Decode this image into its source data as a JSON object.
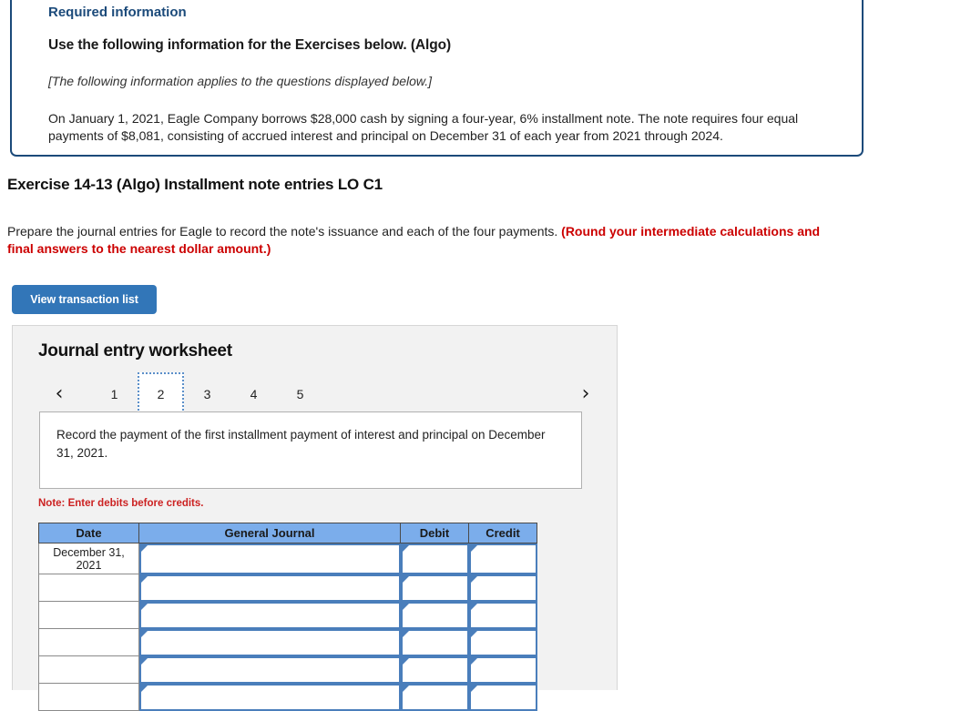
{
  "required_info": {
    "label": "Required information",
    "heading": "Use the following information for the Exercises below. (Algo)",
    "applies_note": "[The following information applies to the questions displayed below.]",
    "body": "On January 1, 2021, Eagle Company borrows $28,000 cash by signing a four-year, 6% installment note. The note requires four equal payments of $8,081, consisting of accrued interest and principal on December 31 of each year from 2021 through 2024.",
    "border_color": "#1b4a7a",
    "label_color": "#1b4a7a"
  },
  "exercise": {
    "title": "Exercise 14-13 (Algo) Installment note entries LO C1",
    "instruction_plain": "Prepare the journal entries for Eagle to record the note's issuance and each of the four payments. ",
    "instruction_emphasis": "(Round your intermediate calculations and final answers to the nearest dollar amount.)",
    "emphasis_color": "#cc0000"
  },
  "buttons": {
    "view_transaction_list": "View transaction list",
    "view_transaction_list_color": "#3276b8"
  },
  "worksheet": {
    "title": "Journal entry worksheet",
    "pager": {
      "prev_icon": "chevron-left-icon",
      "next_icon": "chevron-right-icon",
      "prev_glyph": "‹",
      "next_glyph": "›",
      "tabs": [
        "1",
        "2",
        "3",
        "4",
        "5"
      ],
      "active_tab": "2",
      "active_tab_index": 1
    },
    "description": "Record the payment of the first installment payment of interest and principal on December 31, 2021.",
    "note": "Note: Enter debits before credits.",
    "note_color": "#cc2222",
    "table": {
      "header_color": "#7badeb",
      "columns": [
        "Date",
        "General Journal",
        "Debit",
        "Credit"
      ],
      "rows": [
        {
          "date": "December 31, 2021",
          "general_journal": "",
          "debit": "",
          "credit": ""
        },
        {
          "date": "",
          "general_journal": "",
          "debit": "",
          "credit": ""
        },
        {
          "date": "",
          "general_journal": "",
          "debit": "",
          "credit": ""
        },
        {
          "date": "",
          "general_journal": "",
          "debit": "",
          "credit": ""
        },
        {
          "date": "",
          "general_journal": "",
          "debit": "",
          "credit": ""
        },
        {
          "date": "",
          "general_journal": "",
          "debit": "",
          "credit": ""
        }
      ]
    }
  }
}
